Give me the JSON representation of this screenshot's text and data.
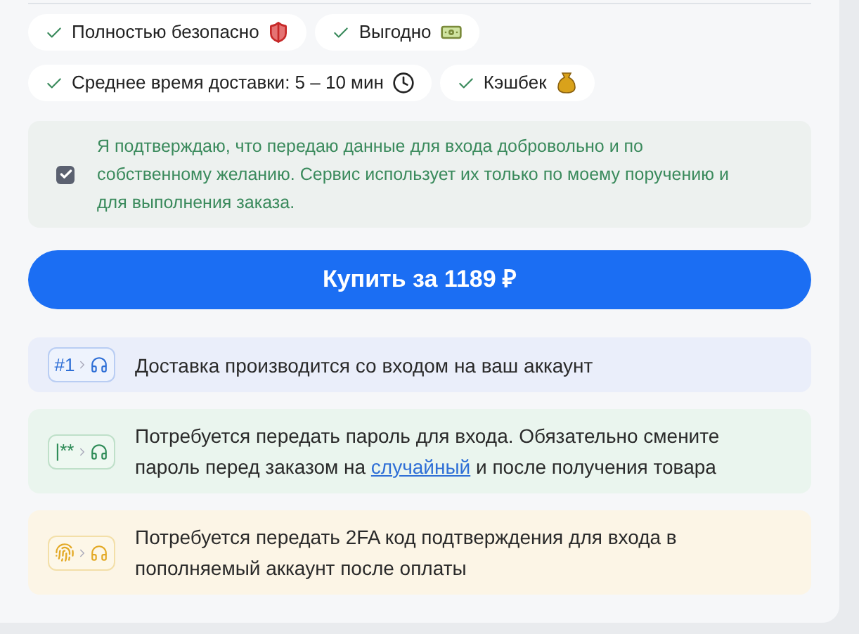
{
  "features": [
    {
      "label": "Полностью безопасно",
      "kind": "shield"
    },
    {
      "label": "Выгодно",
      "kind": "money"
    },
    {
      "label": "Среднее время доставки: 5 – 10 мин",
      "kind": "clock"
    },
    {
      "label": "Кэшбек",
      "kind": "bag"
    }
  ],
  "consent": {
    "checked": true,
    "text": "Я подтверждаю, что передаю данные для входа добровольно и по собственному желанию. Сервис использует их только по моему поручению и для выполнения заказа."
  },
  "buy_button": "Купить за 1189 ₽",
  "notes": [
    {
      "kind": "number",
      "badge": "#1",
      "text": "Доставка производится со входом на ваш аккаунт"
    },
    {
      "kind": "password",
      "badge": "|**",
      "text": "Потребуется передать пароль для входа. Обязательно смените пароль перед заказом на ",
      "link": "случайный",
      "text_after": " и после получения товара"
    },
    {
      "kind": "fingerprint",
      "text": "Потребуется передать 2FA код подтверждения для входа в пополняемый аккаунт после оплаты"
    }
  ]
}
